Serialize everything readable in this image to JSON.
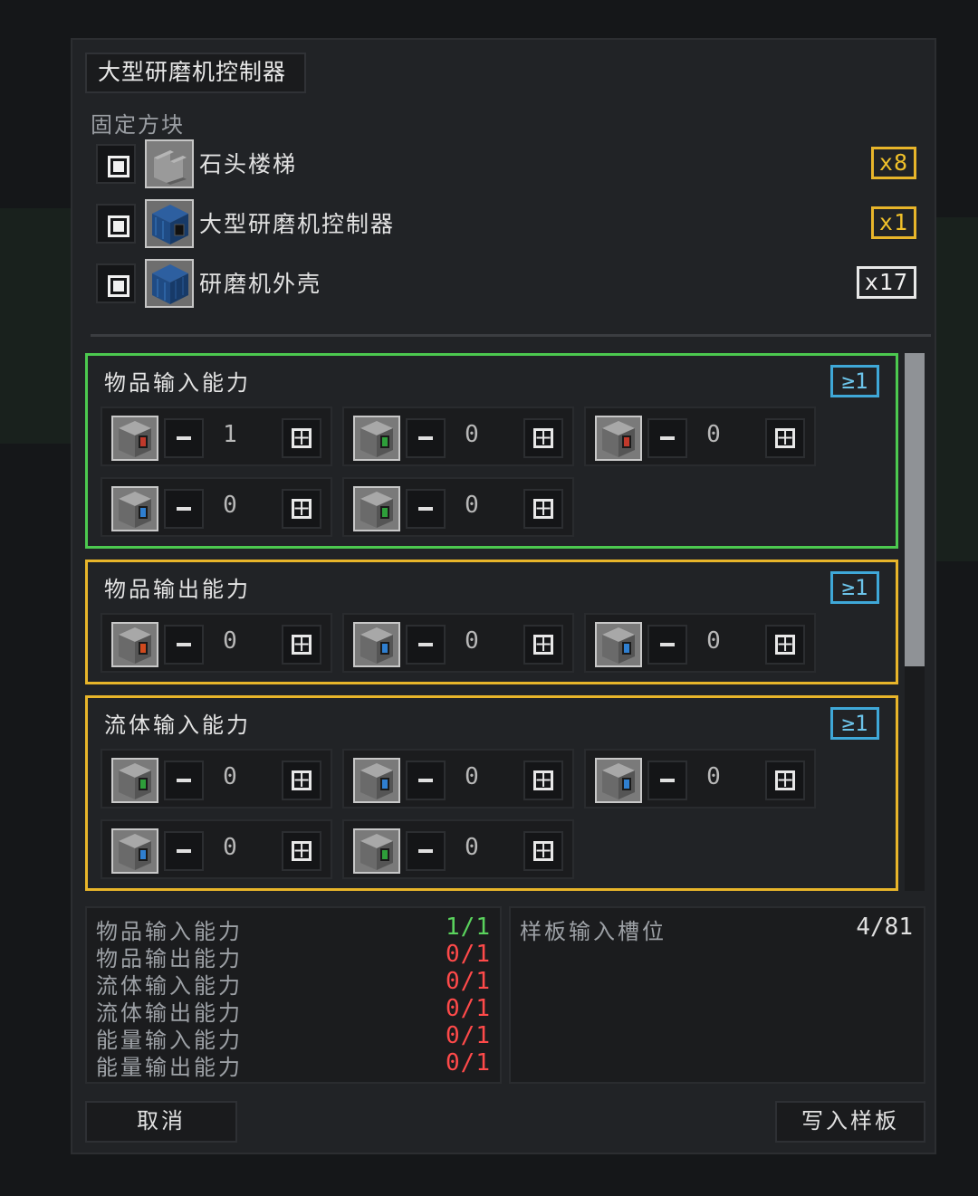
{
  "window": {
    "title": "大型研磨机控制器"
  },
  "fixed_blocks": {
    "label": "固定方块",
    "items": [
      {
        "name": "石头楼梯",
        "count": "x8",
        "count_color": "#e8b52a",
        "icon": "stone-stairs-icon"
      },
      {
        "name": "大型研磨机控制器",
        "count": "x1",
        "count_color": "#e8b52a",
        "icon": "grinder-controller-icon"
      },
      {
        "name": "研磨机外壳",
        "count": "x17",
        "count_color": "#e8e8e8",
        "icon": "grinder-casing-icon"
      }
    ]
  },
  "capabilities": [
    {
      "title": "物品输入能力",
      "requirement": "≥1",
      "border_color": "#4cc94f",
      "slots": [
        {
          "value": "1",
          "accent": "#c0392b"
        },
        {
          "value": "0",
          "accent": "#2e9e3a"
        },
        {
          "value": "0",
          "accent": "#c0392b"
        },
        {
          "value": "0",
          "accent": "#2f7fd0"
        },
        {
          "value": "0",
          "accent": "#2e9e3a"
        }
      ]
    },
    {
      "title": "物品输出能力",
      "requirement": "≥1",
      "border_color": "#e8b52a",
      "slots": [
        {
          "value": "0",
          "accent": "#d04a1e"
        },
        {
          "value": "0",
          "accent": "#2f7fd0"
        },
        {
          "value": "0",
          "accent": "#2f7fd0"
        }
      ]
    },
    {
      "title": "流体输入能力",
      "requirement": "≥1",
      "border_color": "#e8b52a",
      "slots": [
        {
          "value": "0",
          "accent": "#2e9e3a"
        },
        {
          "value": "0",
          "accent": "#2f7fd0"
        },
        {
          "value": "0",
          "accent": "#2f7fd0"
        },
        {
          "value": "0",
          "accent": "#2f7fd0"
        },
        {
          "value": "0",
          "accent": "#2e9e3a"
        }
      ]
    }
  ],
  "summary": [
    {
      "label": "物品输入能力",
      "value": "1/1",
      "status": "ok"
    },
    {
      "label": "物品输出能力",
      "value": "0/1",
      "status": "bad"
    },
    {
      "label": "流体输入能力",
      "value": "0/1",
      "status": "bad"
    },
    {
      "label": "流体输出能力",
      "value": "0/1",
      "status": "bad"
    },
    {
      "label": "能量输入能力",
      "value": "0/1",
      "status": "bad"
    },
    {
      "label": "能量输出能力",
      "value": "0/1",
      "status": "bad"
    }
  ],
  "pattern": {
    "label": "样板输入槽位",
    "value": "4/81"
  },
  "buttons": {
    "cancel": "取消",
    "write": "写入样板"
  },
  "colors": {
    "ok": "#5ad35d",
    "bad": "#ff4a4a",
    "requirement": "#3fa8d8"
  }
}
